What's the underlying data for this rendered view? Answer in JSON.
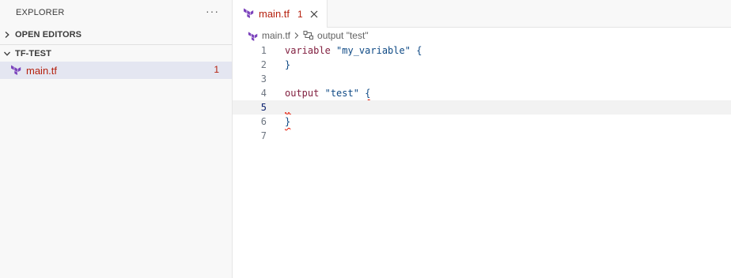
{
  "explorer": {
    "title": "EXPLORER",
    "more_label": "···",
    "open_editors_label": "OPEN EDITORS",
    "project_label": "TF-TEST",
    "file": {
      "name": "main.tf",
      "problems": "1"
    }
  },
  "tab": {
    "name": "main.tf",
    "problems": "1"
  },
  "breadcrumb": {
    "file": "main.tf",
    "symbol": "output \"test\""
  },
  "editor": {
    "line_numbers": [
      "1",
      "2",
      "3",
      "4",
      "5",
      "6",
      "7"
    ],
    "line1": {
      "keyword": "variable",
      "string": "\"my_variable\"",
      "brace": "{"
    },
    "line2": {
      "brace": "}"
    },
    "line4": {
      "keyword": "output",
      "string": "\"test\"",
      "brace": "{"
    },
    "line6": {
      "brace": "}"
    },
    "current_line": "5"
  },
  "colors": {
    "error": "#b5200d",
    "terraform_icon": "#7b42bc",
    "keyword": "#811f3f",
    "string": "#0f4a85"
  }
}
